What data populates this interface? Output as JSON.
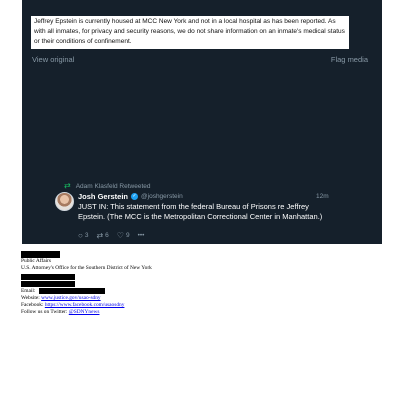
{
  "statement": {
    "text": "Jeffrey Epstein is currently housed at MCC New York and not in a local hospital as has been reported.  As with all inmates, for privacy and security reasons, we do not share information on an inmate's medical status or their conditions of confinement."
  },
  "media_links": {
    "view_original": "View original",
    "flag_media": "Flag media"
  },
  "tweet": {
    "retweeted_by": "Adam Klasfeld Retweeted",
    "author_name": "Josh Gerstein",
    "handle": "@joshgerstein",
    "time": "12m",
    "body": "JUST IN: This statement from the federal Bureau of Prisons re Jeffrey Epstein. (The MCC is the Metropolitan Correctional Center in Manhattan.)",
    "reply_count": "3",
    "retweet_count": "6",
    "like_count": "9",
    "more": "•••",
    "icons": {
      "retweet": "retweet-icon",
      "verified": "verified-badge-icon",
      "reply": "reply-icon",
      "like": "heart-icon",
      "more": "more-icon"
    }
  },
  "footer": {
    "dept": "Public Affairs",
    "office": "U.S. Attorney's Office for the Southern District of New York",
    "email_label": "Email:",
    "website_label": "Website:",
    "website_url": "www.justice.gov/usao-sdny",
    "facebook_label": "Facebook:",
    "facebook_url": "https://www.facebook.com/usaosdny",
    "twitter_label": "Follow us on Twitter:",
    "twitter_handle": "@SDNYnews"
  },
  "colors": {
    "tweet_background": "#15202b",
    "link": "#0000ee",
    "redaction": "#000000"
  }
}
